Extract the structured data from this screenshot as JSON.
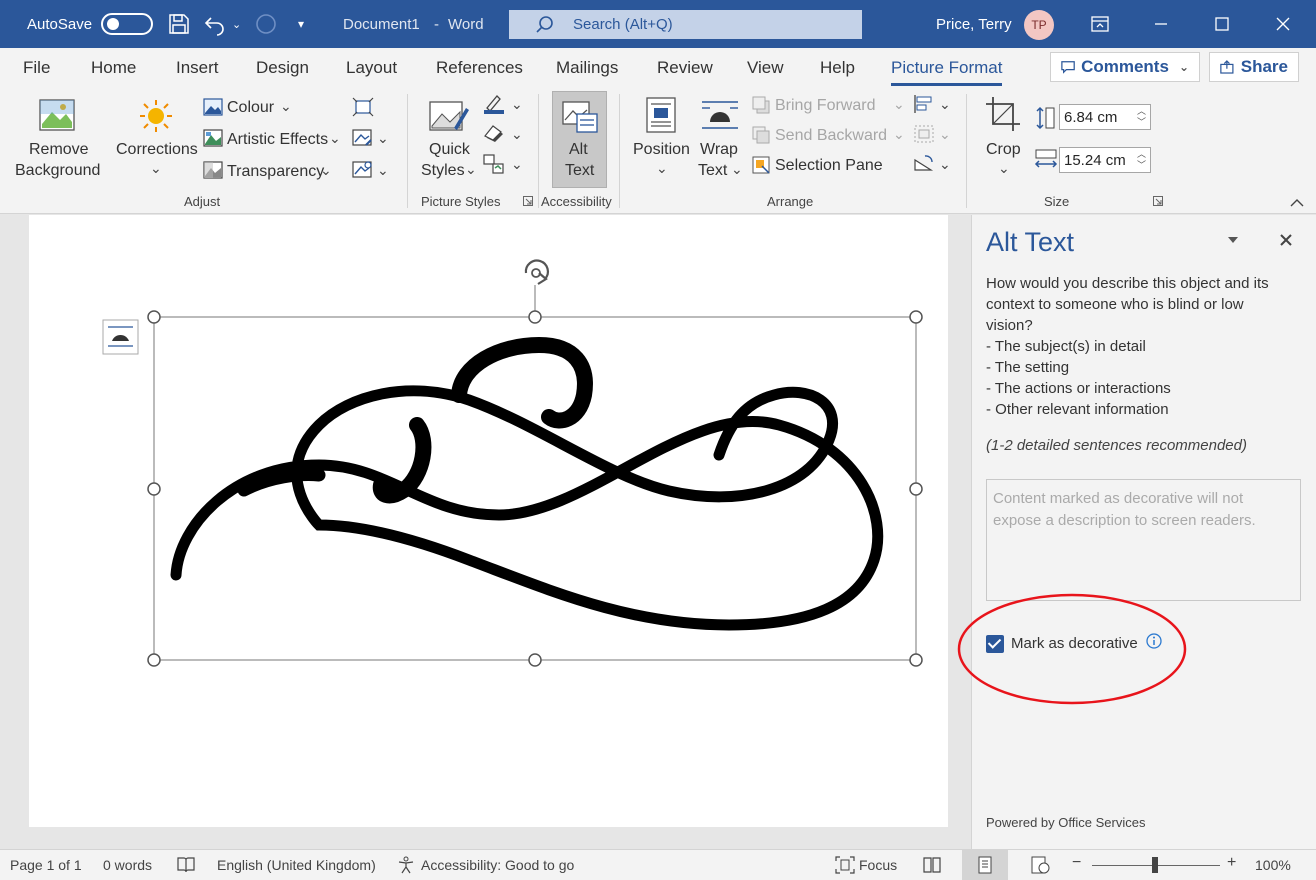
{
  "titlebar": {
    "autosave_label": "AutoSave",
    "document_title": "Document1",
    "separator": "-",
    "app_name": "Word",
    "search_placeholder": "Search (Alt+Q)",
    "user_name": "Price, Terry",
    "user_initials": "TP",
    "brand_color": "#2b579a"
  },
  "tabs": [
    "File",
    "Home",
    "Insert",
    "Design",
    "Layout",
    "References",
    "Mailings",
    "Review",
    "View",
    "Help",
    "Picture Format"
  ],
  "active_tab": "Picture Format",
  "header_buttons": {
    "comments": "Comments",
    "share": "Share"
  },
  "ribbon": {
    "adjust": {
      "remove_background_1": "Remove",
      "remove_background_2": "Background",
      "corrections": "Corrections",
      "colour": "Colour",
      "artistic_effects": "Artistic Effects",
      "transparency": "Transparency",
      "group_label": "Adjust"
    },
    "picture_styles": {
      "quick_styles_1": "Quick",
      "quick_styles_2": "Styles",
      "group_label": "Picture Styles"
    },
    "accessibility": {
      "alt_text_1": "Alt",
      "alt_text_2": "Text",
      "group_label": "Accessibility"
    },
    "arrange": {
      "position": "Position",
      "wrap_text_1": "Wrap",
      "wrap_text_2": "Text",
      "bring_forward": "Bring Forward",
      "send_backward": "Send Backward",
      "selection_pane": "Selection Pane",
      "group_label": "Arrange"
    },
    "size": {
      "crop": "Crop",
      "height": "6.84 cm",
      "width": "15.24 cm",
      "group_label": "Size"
    }
  },
  "alt_text_pane": {
    "title": "Alt Text",
    "instructions": [
      "How would you describe this object and its",
      "context to someone who is blind or low",
      "vision?",
      "- The subject(s) in detail",
      "- The setting",
      "- The actions or interactions",
      "- Other relevant information"
    ],
    "recommendation": "(1-2 detailed sentences recommended)",
    "textarea_placeholder": "Content marked as decorative will not expose a description to screen readers.",
    "checkbox_label": "Mark as decorative",
    "checkbox_checked": true,
    "footer": "Powered by Office Services"
  },
  "statusbar": {
    "page": "Page 1 of 1",
    "words": "0 words",
    "language": "English (United Kingdom)",
    "accessibility": "Accessibility: Good to go",
    "focus": "Focus",
    "zoom": "100%",
    "zoom_minus": "−",
    "zoom_plus": "+"
  }
}
